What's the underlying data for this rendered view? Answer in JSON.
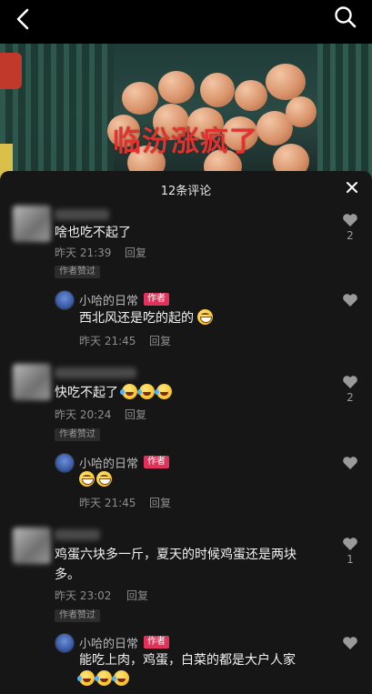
{
  "video": {
    "caption": "临汾涨疯了"
  },
  "panel": {
    "title": "12条评论"
  },
  "comments": [
    {
      "text": "啥也吃不起了",
      "time": "昨天 21:39",
      "reply_label": "回复",
      "liked_tag": "作者赞过",
      "likes": "2"
    },
    {
      "text": "快吃不起了",
      "emojis": [
        "laugh-cry-emoji",
        "laugh-cry-emoji",
        "laugh-cry-emoji"
      ],
      "time": "昨天 20:24",
      "reply_label": "回复",
      "liked_tag": "作者赞过",
      "likes": "2"
    },
    {
      "text_line1": "鸡蛋六块多一斤，夏天的时候鸡蛋还是两块",
      "text_line2": "多。",
      "time": "昨天 23:02",
      "reply_label": "回复",
      "liked_tag": "作者赞过",
      "likes": "1"
    }
  ],
  "replies": [
    {
      "author": "小哈的日常",
      "badge": "作者",
      "text": "西北风还是吃的起的",
      "emojis": [
        "grin-emoji"
      ],
      "time": "昨天 21:45",
      "reply_label": "回复"
    },
    {
      "author": "小哈的日常",
      "badge": "作者",
      "text": "",
      "emojis": [
        "grin-emoji",
        "grin-emoji"
      ],
      "time": "昨天 21:45",
      "reply_label": "回复"
    },
    {
      "author": "小哈的日常",
      "badge": "作者",
      "text": "能吃上肉，鸡蛋，白菜的都是大户人家",
      "emojis": [
        "laugh-cry-emoji",
        "laugh-cry-emoji",
        "laugh-cry-emoji"
      ]
    }
  ],
  "icons": {
    "back": "chevron-left-icon",
    "search": "search-icon",
    "close": "close-icon",
    "like": "heart-icon"
  },
  "colors": {
    "panel_bg": "#161616",
    "caption_red": "#e0322f",
    "author_badge": "#e0325a"
  }
}
